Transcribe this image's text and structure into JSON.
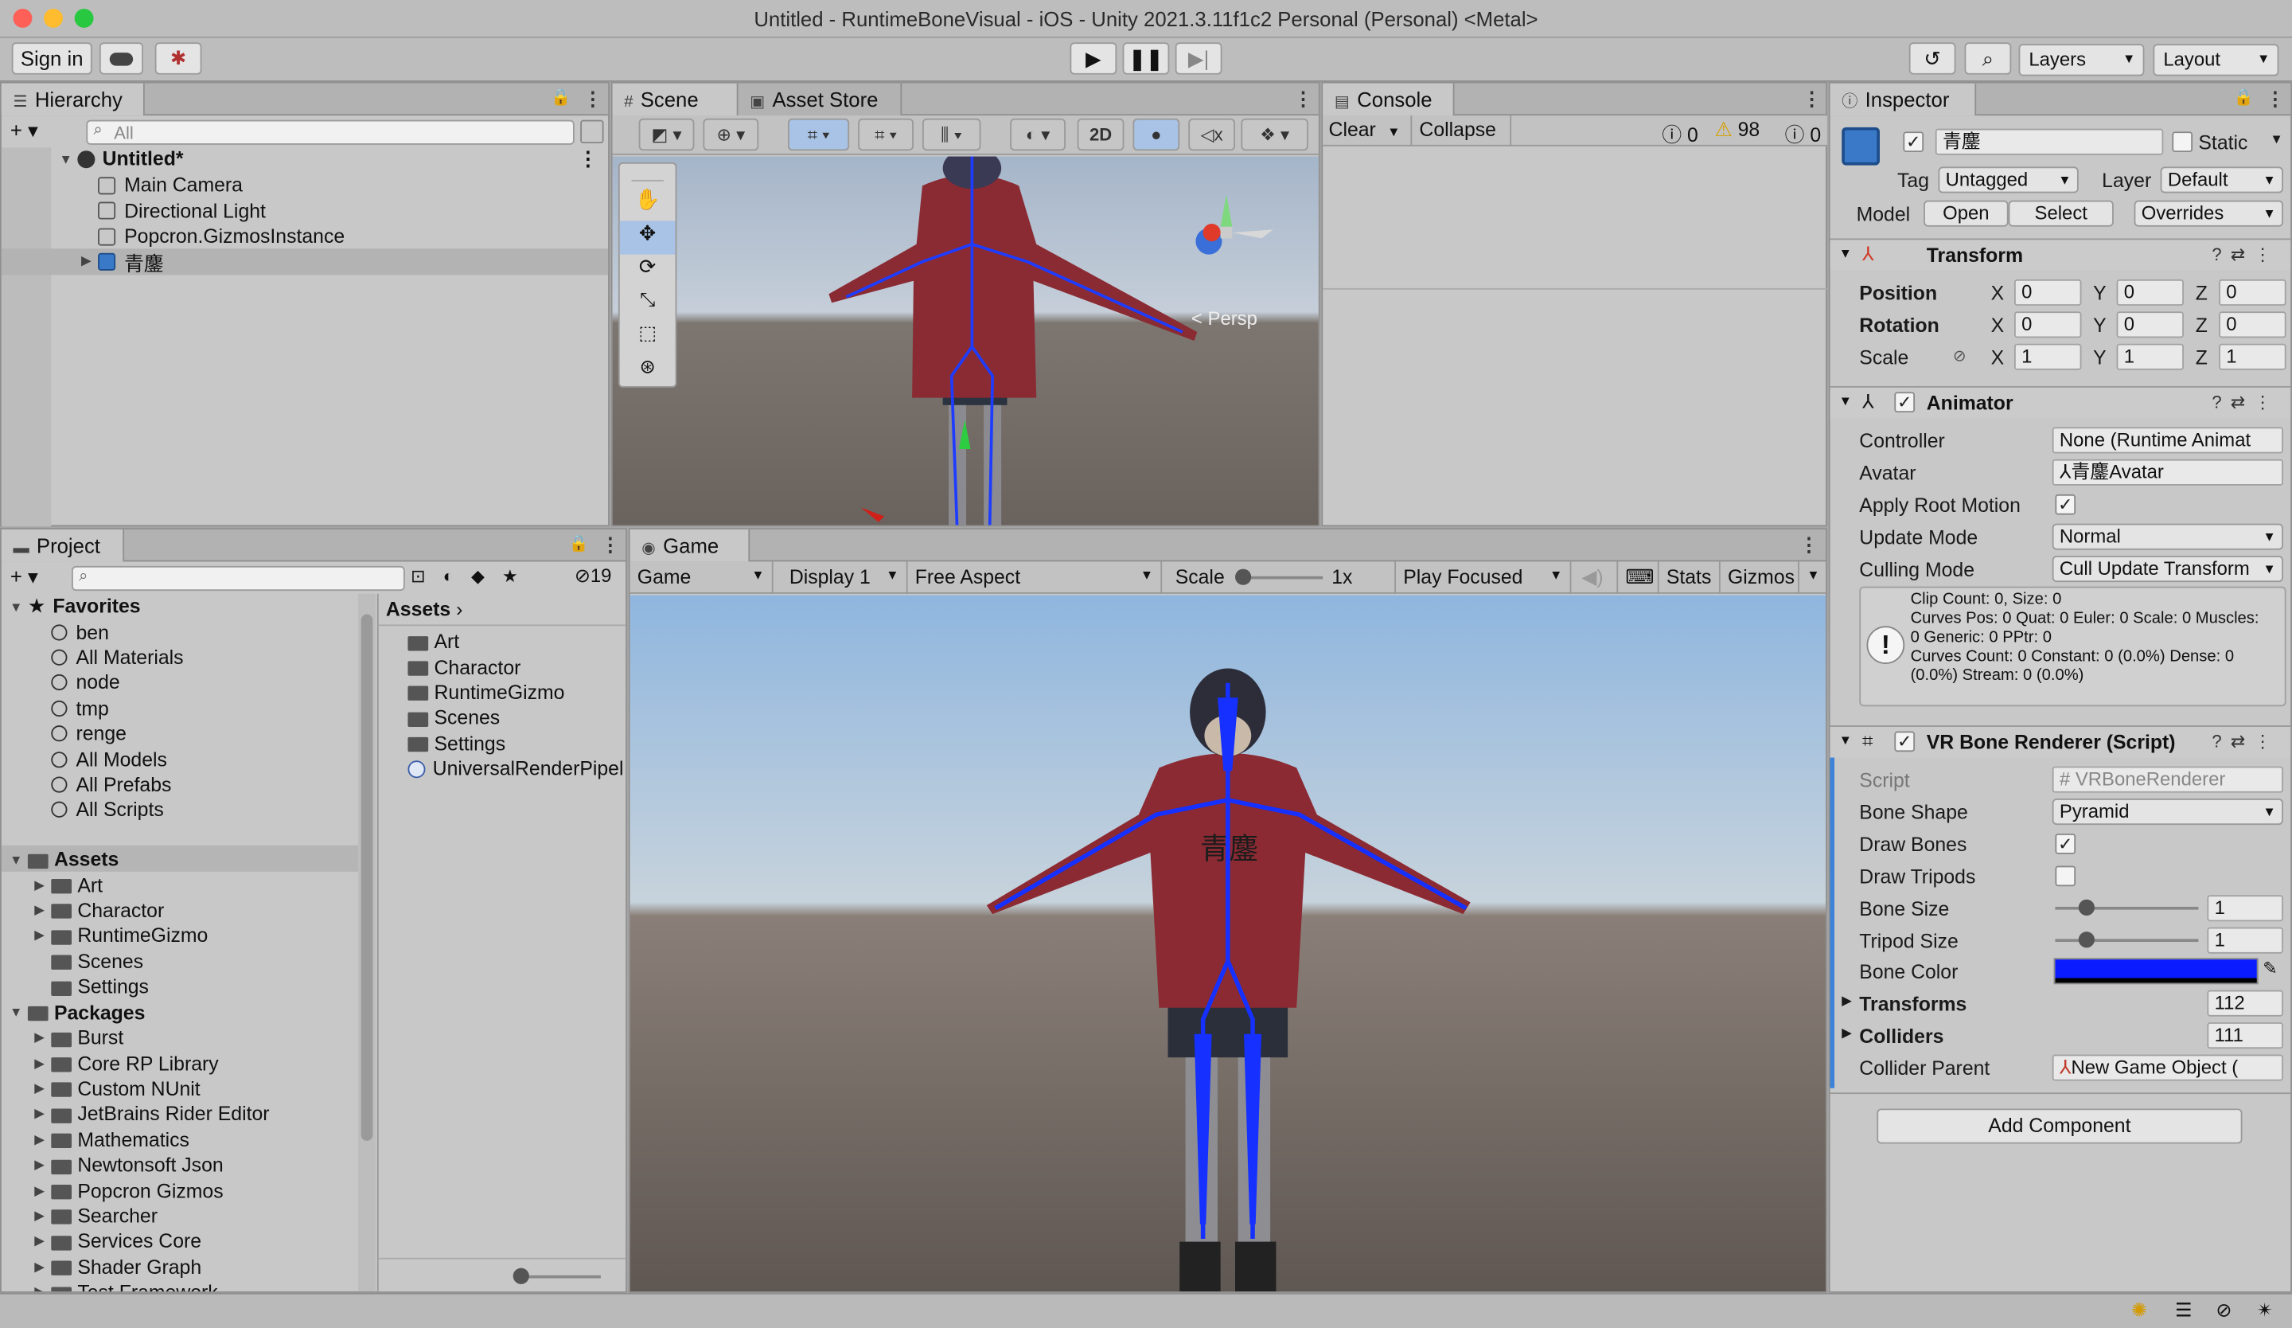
{
  "window": {
    "title": "Untitled - RuntimeBoneVisual - iOS - Unity 2021.3.11f1c2 Personal (Personal) <Metal>"
  },
  "toolbar": {
    "sign_in": "Sign in",
    "layers": "Layers",
    "layout": "Layout"
  },
  "hierarchy": {
    "tab": "Hierarchy",
    "search_placeholder": "All",
    "scene": "Untitled*",
    "items": [
      "Main Camera",
      "Directional Light",
      "Popcron.GizmosInstance",
      "青鏖"
    ]
  },
  "scene_view": {
    "tab": "Scene",
    "tab2": "Asset Store",
    "mode_2d": "2D",
    "persp": "Persp"
  },
  "console": {
    "tab": "Console",
    "clear": "Clear",
    "collapse": "Collapse",
    "errors": "0",
    "warnings": "98",
    "messages": "0"
  },
  "project": {
    "tab": "Project",
    "hidden_count": "19",
    "favorites_label": "Favorites",
    "favorites": [
      "ben",
      "All Materials",
      "node",
      "tmp",
      "renge",
      "All Models",
      "All Prefabs",
      "All Scripts"
    ],
    "assets_label": "Assets",
    "assets": [
      "Art",
      "Charactor",
      "RuntimeGizmo",
      "Scenes",
      "Settings"
    ],
    "packages_label": "Packages",
    "packages": [
      "Burst",
      "Core RP Library",
      "Custom NUnit",
      "JetBrains Rider Editor",
      "Mathematics",
      "Newtonsoft Json",
      "Popcron Gizmos",
      "Searcher",
      "Services Core",
      "Shader Graph",
      "Test Framework"
    ],
    "breadcrumb": "Assets",
    "content": [
      "Art",
      "Charactor",
      "RuntimeGizmo",
      "Scenes",
      "Settings",
      "UniversalRenderPipel"
    ]
  },
  "game_view": {
    "tab": "Game",
    "view": "Game",
    "display": "Display 1",
    "aspect": "Free Aspect",
    "scale_label": "Scale",
    "scale_value": "1x",
    "play_mode": "Play Focused",
    "stats": "Stats",
    "gizmos": "Gizmos"
  },
  "inspector": {
    "tab": "Inspector",
    "object_name": "青鏖",
    "static_label": "Static",
    "tag_label": "Tag",
    "tag_value": "Untagged",
    "layer_label": "Layer",
    "layer_value": "Default",
    "model_label": "Model",
    "open": "Open",
    "select": "Select",
    "overrides": "Overrides",
    "transform": {
      "title": "Transform",
      "position_label": "Position",
      "rotation_label": "Rotation",
      "scale_label": "Scale",
      "x": "X",
      "y": "Y",
      "z": "Z",
      "position": [
        "0",
        "0",
        "0"
      ],
      "rotation": [
        "0",
        "0",
        "0"
      ],
      "scale": [
        "1",
        "1",
        "1"
      ]
    },
    "animator": {
      "title": "Animator",
      "controller_label": "Controller",
      "controller_value": "None (Runtime Animat",
      "avatar_label": "Avatar",
      "avatar_value": "青鏖Avatar",
      "apply_root_label": "Apply Root Motion",
      "update_mode_label": "Update Mode",
      "update_mode_value": "Normal",
      "culling_mode_label": "Culling Mode",
      "culling_mode_value": "Cull Update Transform",
      "info_line1": "Clip Count: 0, Size: 0",
      "info_line2": "Curves Pos: 0 Quat: 0 Euler: 0 Scale: 0 Muscles:",
      "info_line3": "0 Generic: 0 PPtr: 0",
      "info_line4": "Curves Count: 0 Constant: 0 (0.0%) Dense: 0",
      "info_line5": "(0.0%) Stream: 0 (0.0%)"
    },
    "bone_renderer": {
      "title": "VR Bone Renderer (Script)",
      "script_label": "Script",
      "script_value": "VRBoneRenderer",
      "bone_shape_label": "Bone Shape",
      "bone_shape_value": "Pyramid",
      "draw_bones_label": "Draw Bones",
      "draw_tripods_label": "Draw Tripods",
      "bone_size_label": "Bone Size",
      "bone_size_value": "1",
      "tripod_size_label": "Tripod Size",
      "tripod_size_value": "1",
      "bone_color_label": "Bone Color",
      "bone_color": "#0a1cff",
      "transforms_label": "Transforms",
      "transforms_value": "112",
      "colliders_label": "Colliders",
      "colliders_value": "111",
      "collider_parent_label": "Collider Parent",
      "collider_parent_value": "New Game Object ("
    },
    "add_component": "Add Component"
  }
}
